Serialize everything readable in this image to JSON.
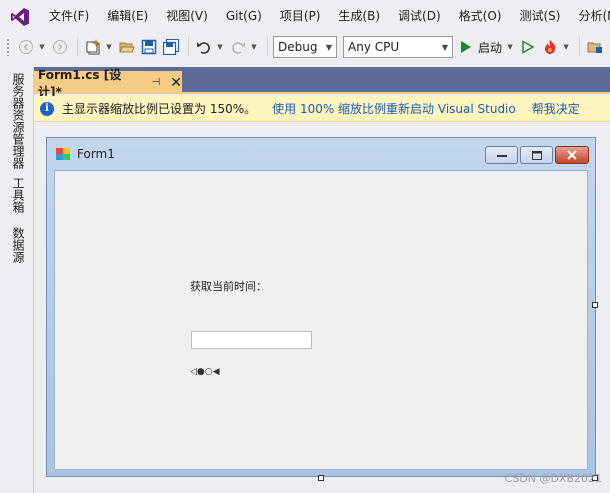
{
  "menu": {
    "items": [
      "文件(F)",
      "编辑(E)",
      "视图(V)",
      "Git(G)",
      "项目(P)",
      "生成(B)",
      "调试(D)",
      "格式(O)",
      "测试(S)",
      "分析(N"
    ]
  },
  "toolbar": {
    "config_value": "Debug",
    "platform_value": "Any CPU",
    "start_label": "启动"
  },
  "sidebar": {
    "tabs": [
      "服务器资源管理器",
      "工具箱",
      "数据源"
    ]
  },
  "document": {
    "tab_label": "Form1.cs [设计]*",
    "pin_glyph": "⊣",
    "close_glyph": "✕"
  },
  "infobar": {
    "icon_glyph": "i",
    "message": "主显示器缩放比例已设置为 150%。",
    "restart_link": "使用 100% 缩放比例重新启动 Visual Studio",
    "help_link": "帮我决定"
  },
  "form": {
    "title": "Form1",
    "label_text": "获取当前时间：",
    "textbox_value": "",
    "timer_glyph": "◁●○◀"
  },
  "watermark": "CSDN @DXB2021",
  "colors": {
    "accent_tab": "#f5cc84",
    "tab_strip": "#5d6b99",
    "infobar_bg": "#fdf4bf",
    "link": "#1a5fb4",
    "vs_purple": "#68217a"
  }
}
